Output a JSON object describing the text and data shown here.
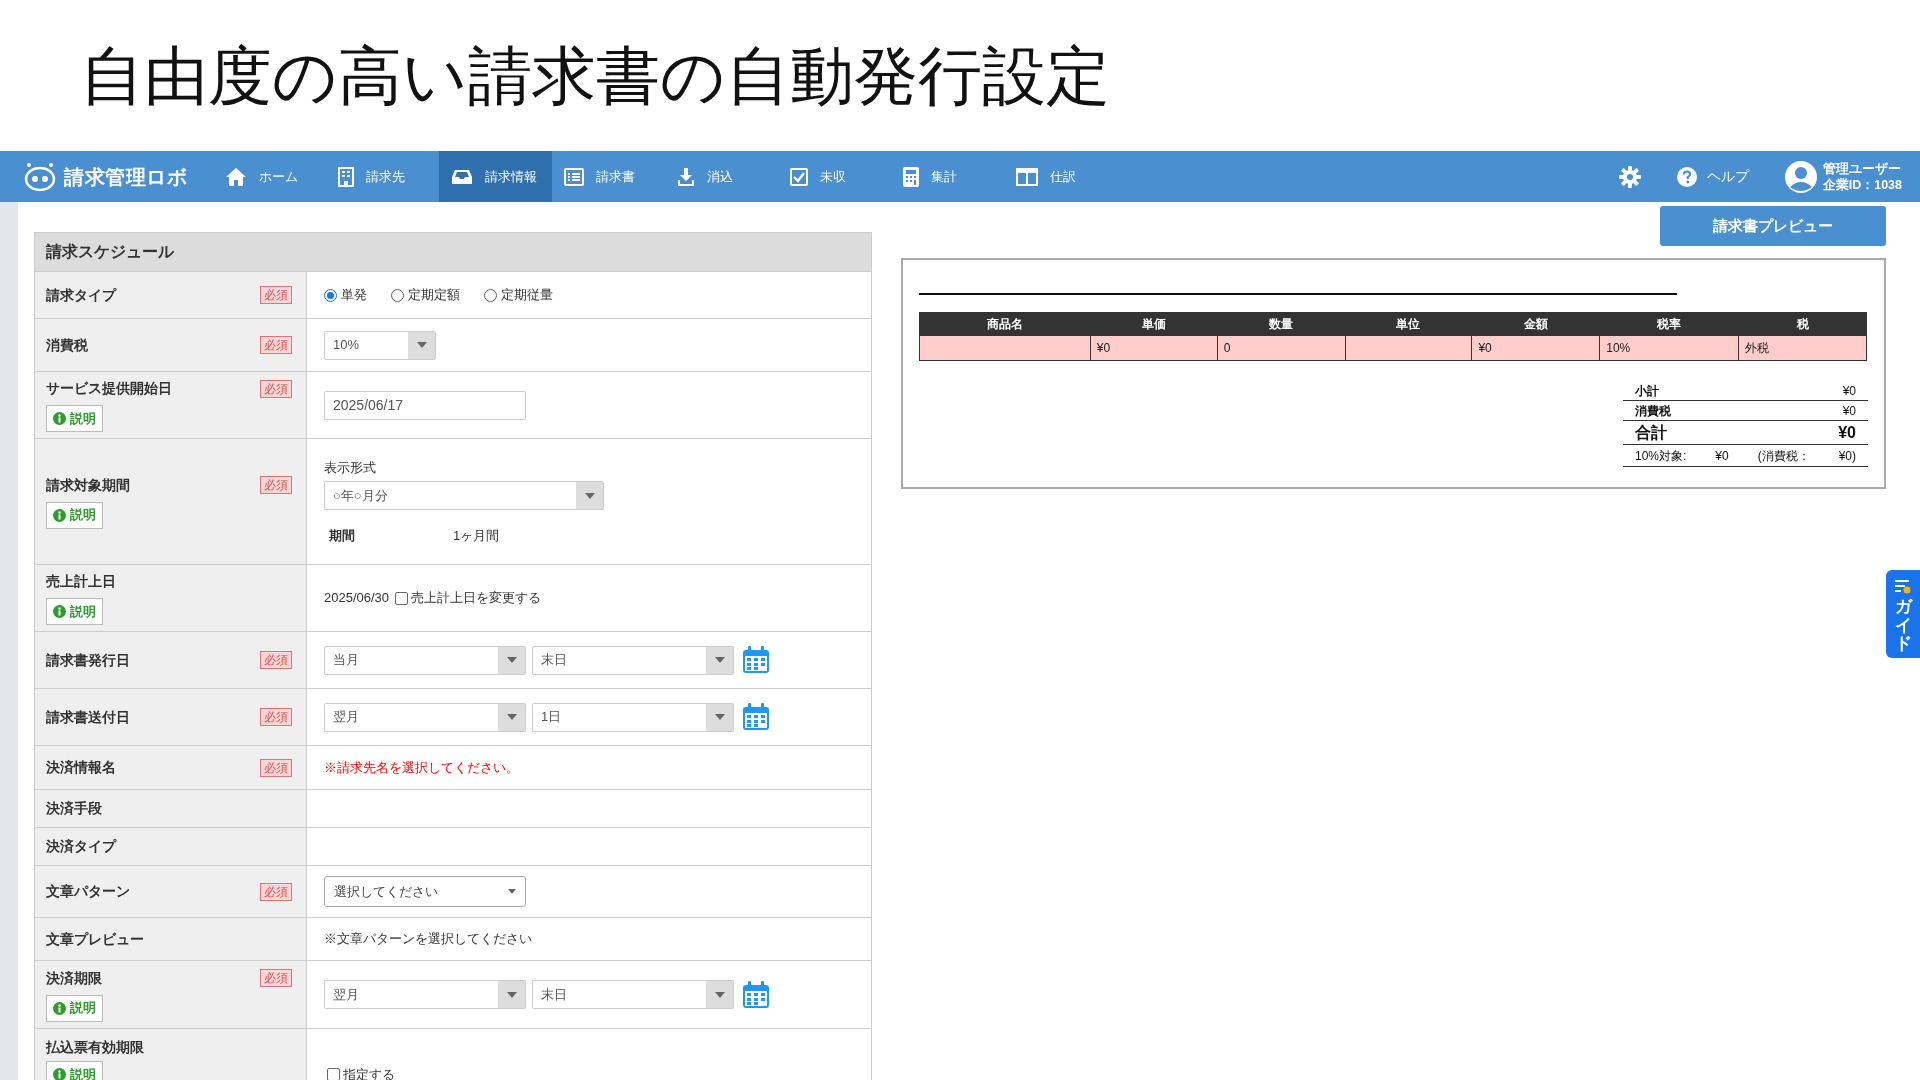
{
  "slide_title": "自由度の高い請求書の自動発行設定",
  "app": {
    "logo": "請求管理ロボ",
    "nav": [
      {
        "label": "ホーム",
        "selected": false
      },
      {
        "label": "請求先",
        "selected": false
      },
      {
        "label": "請求情報",
        "selected": true
      },
      {
        "label": "請求書",
        "selected": false
      },
      {
        "label": "消込",
        "selected": false
      },
      {
        "label": "未収",
        "selected": false
      },
      {
        "label": "集計",
        "selected": false
      },
      {
        "label": "仕訳",
        "selected": false
      }
    ],
    "help": "ヘルプ",
    "user": {
      "name": "管理ユーザー",
      "company": "企業ID：1038"
    }
  },
  "schedule": {
    "title": "請求スケジュール",
    "rows": [
      {
        "kind": "radio",
        "label": "請求タイプ",
        "required": "必須",
        "options": [
          {
            "label": "単発",
            "selected": true
          },
          {
            "label": "定期定額",
            "selected": false
          },
          {
            "label": "定期従量",
            "selected": false
          }
        ]
      },
      {
        "kind": "select",
        "label": "消費税",
        "required": "必須",
        "value": "10%"
      },
      {
        "kind": "date",
        "label": "サービス提供開始日",
        "required": "必須",
        "help": "説明",
        "value": "2025/06/17"
      },
      {
        "kind": "period",
        "label": "請求対象期間",
        "required": "必須",
        "help": "説明",
        "format_label": "表示形式",
        "value": "○年○月分",
        "period_label": "期間",
        "period_value": "1ヶ月間"
      },
      {
        "kind": "sales_date",
        "label": "売上計上日",
        "help": "説明",
        "value": "2025/06/30",
        "checkbox": {
          "label": "売上計上日を変更する",
          "checked": false
        }
      },
      {
        "kind": "select_pair",
        "label": "請求書発行日",
        "required": "必須",
        "values": [
          "当月",
          "末日"
        ]
      },
      {
        "kind": "select_pair",
        "label": "請求書送付日",
        "required": "必須",
        "values": [
          "翌月",
          "1日"
        ]
      },
      {
        "kind": "error",
        "label": "決済情報名",
        "required": "必須",
        "value": "※請求先名を選択してください。"
      },
      {
        "kind": "empty",
        "label": "決済手段"
      },
      {
        "kind": "empty",
        "label": "決済タイプ"
      },
      {
        "kind": "dropdown",
        "label": "文章パターン",
        "required": "必須",
        "value": "選択してください"
      },
      {
        "kind": "text",
        "label": "文章プレビュー",
        "value": "※文章パターンを選択してください"
      },
      {
        "kind": "select_pair",
        "label": "決済期限",
        "required": "必須",
        "help": "説明",
        "values": [
          "翌月",
          "末日"
        ]
      },
      {
        "kind": "checkbox",
        "label": "払込票有効期限",
        "help": "説明",
        "checkbox": {
          "label": "指定する",
          "checked": false
        }
      }
    ]
  },
  "preview": {
    "button": "請求書プレビュー",
    "columns": [
      "商品名",
      "単価",
      "数量",
      "単位",
      "金額",
      "税率",
      "税"
    ],
    "rows": [
      [
        "",
        "¥0",
        "0",
        "",
        "¥0",
        "10%",
        "外税"
      ]
    ],
    "totals": [
      {
        "label": "小計",
        "value": "¥0",
        "kind": "normal"
      },
      {
        "label": "消費税",
        "value": "¥0",
        "kind": "normal"
      },
      {
        "label": "合計",
        "value": "¥0",
        "kind": "grand"
      }
    ],
    "tax_line": [
      "10%対象:",
      "¥0",
      "(消費税：",
      "¥0)"
    ]
  },
  "guide": "ガイド"
}
